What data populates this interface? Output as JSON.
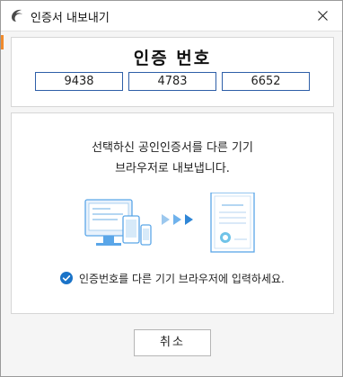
{
  "window": {
    "title": "인증서 내보내기",
    "icon": "app-logo-icon"
  },
  "code_panel": {
    "title": "인증 번호",
    "codes": [
      "9438",
      "4783",
      "6652"
    ]
  },
  "info_panel": {
    "line1": "선택하신 공인인증서를 다른 기기",
    "line2": "브라우저로 내보냅니다.",
    "confirm_text": "인증번호를 다른 기기 브라우저에 입력하세요."
  },
  "buttons": {
    "cancel_label": "취소"
  },
  "colors": {
    "accent": "#1a73c8",
    "code_border": "#2e5fa8",
    "illustration": "#5aa6e8",
    "strip": "#f08a2c"
  }
}
